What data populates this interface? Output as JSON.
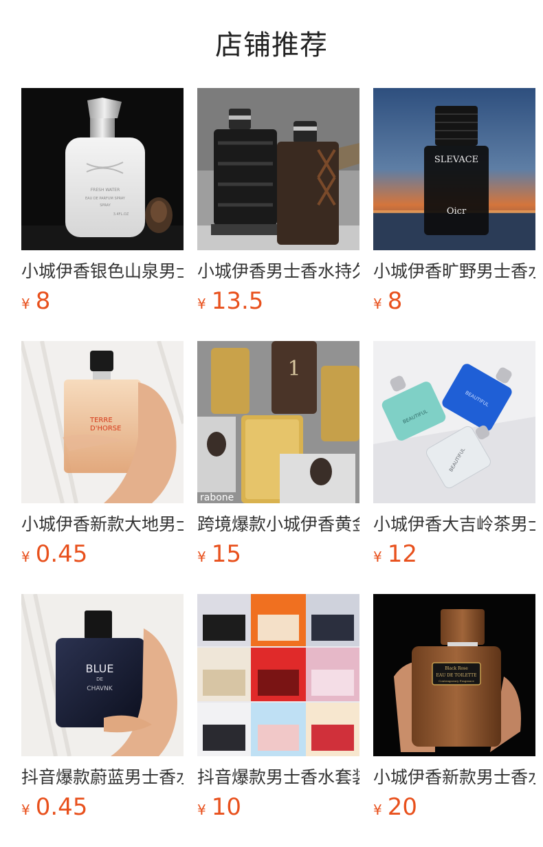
{
  "page": {
    "title": "店铺推荐"
  },
  "currency_symbol": "¥",
  "products": [
    {
      "name": "小城伊香银色山泉男士香水",
      "price": "8",
      "bottle_texts": [
        "FRESH WATER",
        "EAU DE PARFUM SPRAY",
        "SPRAY",
        "3.4FL.OZ"
      ]
    },
    {
      "name": "小城伊香男士香水持久留香",
      "price": "13.5",
      "bottle_texts": []
    },
    {
      "name": "小城伊香旷野男士香水",
      "price": "8",
      "bottle_texts": [
        "SLEVACE",
        "Oicr"
      ]
    },
    {
      "name": "小城伊香新款大地男士香水",
      "price": "0.45",
      "bottle_texts": [
        "TERRE",
        "D'HORSE"
      ]
    },
    {
      "name": "跨境爆款小城伊香黄金男士香水",
      "price": "15",
      "bottle_texts": [
        "1",
        "rabone"
      ]
    },
    {
      "name": "小城伊香大吉岭茶男士香水",
      "price": "12",
      "bottle_texts": [
        "BEAUTIFUL",
        "BEAUTIFUL",
        "BEAUTIFUL"
      ]
    },
    {
      "name": "抖音爆款蔚蓝男士香水",
      "price": "0.45",
      "bottle_texts": [
        "BLUE",
        "DE",
        "CHAVNK"
      ]
    },
    {
      "name": "抖音爆款男士香水套装",
      "price": "10",
      "bottle_texts": []
    },
    {
      "name": "小城伊香新款男士香水",
      "price": "20",
      "bottle_texts": [
        "Black Rose",
        "EAU DE TOILETTE",
        "Contemporary Fragrance"
      ]
    }
  ],
  "colors": {
    "price": "#e8501c",
    "title": "#222222",
    "name": "#333333"
  }
}
